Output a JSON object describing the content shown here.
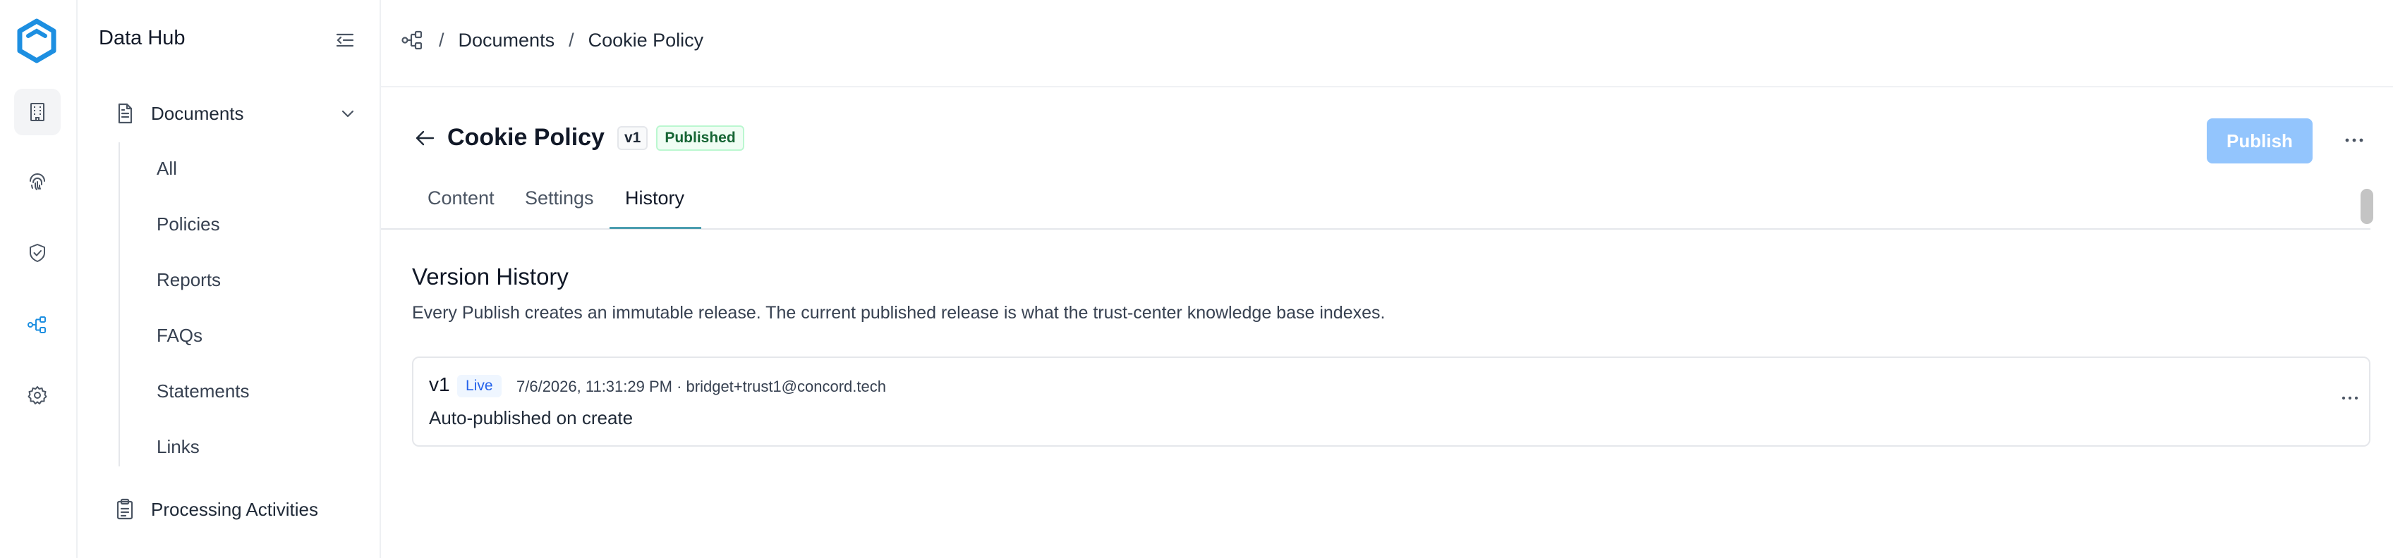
{
  "app": {
    "title": "Data Hub",
    "brand_color": "#1d8fe1"
  },
  "rail": {
    "items": [
      {
        "icon": "building-icon",
        "active": true
      },
      {
        "icon": "fingerprint-icon",
        "active": false
      },
      {
        "icon": "shield-check-icon",
        "active": false
      },
      {
        "icon": "data-flow-icon",
        "active": false
      },
      {
        "icon": "gear-icon",
        "active": false
      }
    ]
  },
  "sidebar": {
    "group_label": "Documents",
    "items": [
      {
        "label": "All"
      },
      {
        "label": "Policies"
      },
      {
        "label": "Reports"
      },
      {
        "label": "FAQs"
      },
      {
        "label": "Statements"
      },
      {
        "label": "Links"
      }
    ],
    "processing_label": "Processing Activities"
  },
  "breadcrumb": {
    "items": [
      "Documents",
      "Cookie Policy"
    ],
    "separator": "/"
  },
  "document": {
    "title": "Cookie Policy",
    "version": "v1",
    "status": "Published",
    "publish_label": "Publish"
  },
  "tabs": [
    {
      "label": "Content",
      "active": false
    },
    {
      "label": "Settings",
      "active": false
    },
    {
      "label": "History",
      "active": true
    }
  ],
  "history": {
    "title": "Version History",
    "description": "Every Publish creates an immutable release. The current published release is what the trust-center knowledge base indexes.",
    "releases": [
      {
        "version": "v1",
        "badge": "Live",
        "meta": "7/6/2026, 11:31:29 PM · bridget+trust1@concord.tech",
        "note": "Auto-published on create"
      }
    ]
  }
}
